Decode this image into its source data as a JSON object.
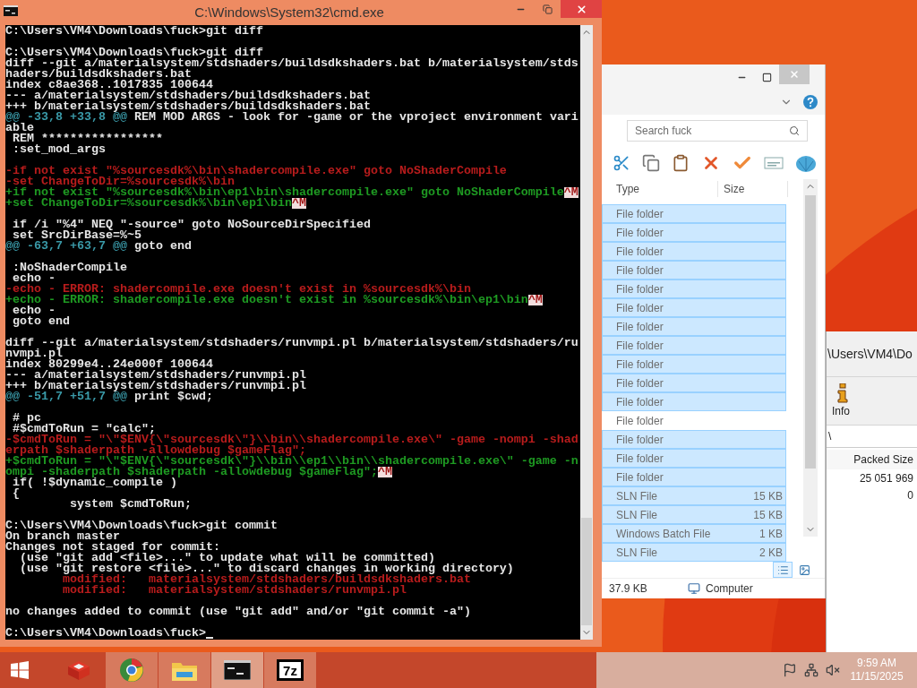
{
  "console_window": {
    "title": "C:\\Windows\\System32\\cmd.exe",
    "lines": [
      {
        "kind": "text",
        "segments": [
          {
            "kind": "text",
            "text": "C:\\Users\\VM4\\Downloads\\fuck>git diff"
          }
        ]
      },
      {
        "kind": "blank"
      },
      {
        "kind": "text",
        "segments": [
          {
            "kind": "text",
            "text": "C:\\Users\\VM4\\Downloads\\fuck>git diff"
          }
        ]
      },
      {
        "kind": "text",
        "segments": [
          {
            "kind": "text",
            "text": "diff --git a/materialsystem/stdshaders/buildsdkshaders.bat b/materialsystem/stds"
          }
        ]
      },
      {
        "kind": "text",
        "segments": [
          {
            "kind": "text",
            "text": "haders/buildsdkshaders.bat"
          }
        ]
      },
      {
        "kind": "text",
        "segments": [
          {
            "kind": "text",
            "text": "index c8ae368..1017835 100644"
          }
        ]
      },
      {
        "kind": "text",
        "segments": [
          {
            "kind": "text",
            "text": "--- a/materialsystem/stdshaders/buildsdkshaders.bat"
          }
        ]
      },
      {
        "kind": "text",
        "segments": [
          {
            "kind": "text",
            "text": "+++ b/materialsystem/stdshaders/buildsdkshaders.bat"
          }
        ]
      },
      {
        "kind": "text",
        "segments": [
          {
            "kind": "hunk",
            "text": "@@ -33,8 +33,8 @@"
          },
          {
            "kind": "text",
            "text": " REM MOD ARGS - look for -game or the vproject environment vari"
          }
        ]
      },
      {
        "kind": "text",
        "segments": [
          {
            "kind": "text",
            "text": "able"
          }
        ]
      },
      {
        "kind": "text",
        "segments": [
          {
            "kind": "text",
            "text": " REM *****************"
          }
        ]
      },
      {
        "kind": "text",
        "segments": [
          {
            "kind": "text",
            "text": " :set_mod_args"
          }
        ]
      },
      {
        "kind": "blank"
      },
      {
        "kind": "text",
        "segments": [
          {
            "kind": "removed",
            "text": "-if not exist \"%sourcesdk%\\bin\\shadercompile.exe\" goto NoShaderCompile"
          }
        ]
      },
      {
        "kind": "text",
        "segments": [
          {
            "kind": "removed",
            "text": "-set ChangeToDir=%sourcesdk%\\bin"
          }
        ]
      },
      {
        "kind": "text",
        "segments": [
          {
            "kind": "added",
            "text": "+if not exist \"%sourcesdk%\\bin\\ep1\\bin\\shadercompile.exe\" goto NoShaderCompile"
          },
          {
            "kind": "cr",
            "text": "^M"
          }
        ]
      },
      {
        "kind": "text",
        "segments": [
          {
            "kind": "added",
            "text": "+set ChangeToDir=%sourcesdk%\\bin\\ep1\\bin"
          },
          {
            "kind": "cr",
            "text": "^M"
          }
        ]
      },
      {
        "kind": "blank"
      },
      {
        "kind": "text",
        "segments": [
          {
            "kind": "text",
            "text": " if /i \"%4\" NEQ \"-source\" goto NoSourceDirSpecified"
          }
        ]
      },
      {
        "kind": "text",
        "segments": [
          {
            "kind": "text",
            "text": " set SrcDirBase=%~5"
          }
        ]
      },
      {
        "kind": "text",
        "segments": [
          {
            "kind": "hunk",
            "text": "@@ -63,7 +63,7 @@"
          },
          {
            "kind": "text",
            "text": " goto end"
          }
        ]
      },
      {
        "kind": "blank"
      },
      {
        "kind": "text",
        "segments": [
          {
            "kind": "text",
            "text": " :NoShaderCompile"
          }
        ]
      },
      {
        "kind": "text",
        "segments": [
          {
            "kind": "text",
            "text": " echo -"
          }
        ]
      },
      {
        "kind": "text",
        "segments": [
          {
            "kind": "removed",
            "text": "-echo - ERROR: shadercompile.exe doesn't exist in %sourcesdk%\\bin"
          }
        ]
      },
      {
        "kind": "text",
        "segments": [
          {
            "kind": "added",
            "text": "+echo - ERROR: shadercompile.exe doesn't exist in %sourcesdk%\\bin\\ep1\\bin"
          },
          {
            "kind": "cr",
            "text": "^M"
          }
        ]
      },
      {
        "kind": "text",
        "segments": [
          {
            "kind": "text",
            "text": " echo -"
          }
        ]
      },
      {
        "kind": "text",
        "segments": [
          {
            "kind": "text",
            "text": " goto end"
          }
        ]
      },
      {
        "kind": "blank"
      },
      {
        "kind": "text",
        "segments": [
          {
            "kind": "text",
            "text": "diff --git a/materialsystem/stdshaders/runvmpi.pl b/materialsystem/stdshaders/ru"
          }
        ]
      },
      {
        "kind": "text",
        "segments": [
          {
            "kind": "text",
            "text": "nvmpi.pl"
          }
        ]
      },
      {
        "kind": "text",
        "segments": [
          {
            "kind": "text",
            "text": "index 80299e4..24e000f 100644"
          }
        ]
      },
      {
        "kind": "text",
        "segments": [
          {
            "kind": "text",
            "text": "--- a/materialsystem/stdshaders/runvmpi.pl"
          }
        ]
      },
      {
        "kind": "text",
        "segments": [
          {
            "kind": "text",
            "text": "+++ b/materialsystem/stdshaders/runvmpi.pl"
          }
        ]
      },
      {
        "kind": "text",
        "segments": [
          {
            "kind": "hunk",
            "text": "@@ -51,7 +51,7 @@"
          },
          {
            "kind": "text",
            "text": " print $cwd;"
          }
        ]
      },
      {
        "kind": "blank"
      },
      {
        "kind": "text",
        "segments": [
          {
            "kind": "text",
            "text": " # pc"
          }
        ]
      },
      {
        "kind": "text",
        "segments": [
          {
            "kind": "text",
            "text": " #$cmdToRun = \"calc\";"
          }
        ]
      },
      {
        "kind": "text",
        "segments": [
          {
            "kind": "removed",
            "text": "-$cmdToRun = \"\\\"$ENV{\\\"sourcesdk\\\"}\\\\bin\\\\shadercompile.exe\\\" -game -nompi -shad"
          }
        ]
      },
      {
        "kind": "text",
        "segments": [
          {
            "kind": "removed",
            "text": "erpath $shaderpath -allowdebug $gameFlag\";"
          }
        ]
      },
      {
        "kind": "text",
        "segments": [
          {
            "kind": "added",
            "text": "+$cmdToRun = \"\\\"$ENV{\\\"sourcesdk\\\"}\\\\bin\\\\ep1\\\\bin\\\\shadercompile.exe\\\" -game -n"
          }
        ]
      },
      {
        "kind": "text",
        "segments": [
          {
            "kind": "added",
            "text": "ompi -shaderpath $shaderpath -allowdebug $gameFlag\";"
          },
          {
            "kind": "cr",
            "text": "^M"
          }
        ]
      },
      {
        "kind": "text",
        "segments": [
          {
            "kind": "text",
            "text": " if( !$dynamic_compile )"
          }
        ]
      },
      {
        "kind": "text",
        "segments": [
          {
            "kind": "text",
            "text": " {"
          }
        ]
      },
      {
        "kind": "text",
        "segments": [
          {
            "kind": "text",
            "text": "         system $cmdToRun;"
          }
        ]
      },
      {
        "kind": "blank"
      },
      {
        "kind": "text",
        "segments": [
          {
            "kind": "text",
            "text": "C:\\Users\\VM4\\Downloads\\fuck>git commit"
          }
        ]
      },
      {
        "kind": "text",
        "segments": [
          {
            "kind": "text",
            "text": "On branch master"
          }
        ]
      },
      {
        "kind": "text",
        "segments": [
          {
            "kind": "text",
            "text": "Changes not staged for commit:"
          }
        ]
      },
      {
        "kind": "text",
        "segments": [
          {
            "kind": "text",
            "text": "  (use \"git add <file>...\" to update what will be committed)"
          }
        ]
      },
      {
        "kind": "text",
        "segments": [
          {
            "kind": "text",
            "text": "  (use \"git restore <file>...\" to discard changes in working directory)"
          }
        ]
      },
      {
        "kind": "text",
        "segments": [
          {
            "kind": "modified",
            "text": "        modified:   materialsystem/stdshaders/buildsdkshaders.bat"
          }
        ]
      },
      {
        "kind": "text",
        "segments": [
          {
            "kind": "modified",
            "text": "        modified:   materialsystem/stdshaders/runvmpi.pl"
          }
        ]
      },
      {
        "kind": "blank"
      },
      {
        "kind": "text",
        "segments": [
          {
            "kind": "text",
            "text": "no changes added to commit (use \"git add\" and/or \"git commit -a\")"
          }
        ]
      },
      {
        "kind": "blank"
      },
      {
        "kind": "text",
        "cursor": true,
        "segments": [
          {
            "kind": "text",
            "text": "C:\\Users\\VM4\\Downloads\\fuck>"
          }
        ]
      }
    ]
  },
  "explorer_window": {
    "search": {
      "placeholder": "Search fuck"
    },
    "columns": [
      "Type",
      "Size"
    ],
    "rows": [
      {
        "type": "File folder",
        "selected": true
      },
      {
        "type": "File folder",
        "selected": true
      },
      {
        "type": "File folder",
        "selected": true
      },
      {
        "type": "File folder",
        "selected": true
      },
      {
        "type": "File folder",
        "selected": true
      },
      {
        "type": "File folder",
        "selected": true
      },
      {
        "type": "File folder",
        "selected": true
      },
      {
        "type": "File folder",
        "selected": true
      },
      {
        "type": "File folder",
        "selected": true
      },
      {
        "type": "File folder",
        "selected": true
      },
      {
        "type": "File folder",
        "selected": true
      },
      {
        "type": "File folder",
        "selected": false
      },
      {
        "type": "File folder",
        "selected": true
      },
      {
        "type": "File folder",
        "selected": true
      },
      {
        "type": "File folder",
        "selected": true
      },
      {
        "type": "SLN File",
        "size": "15 KB",
        "selected": true
      },
      {
        "type": "SLN File",
        "size": "15 KB",
        "selected": true
      },
      {
        "type": "Windows Batch File",
        "size": "1 KB",
        "selected": true
      },
      {
        "type": "SLN File",
        "size": "2 KB",
        "selected": true
      }
    ],
    "views": [
      {
        "kind": "details",
        "selected": true
      },
      {
        "kind": "large_icons",
        "selected": false
      }
    ],
    "status_bar": {
      "size": "37.9 KB",
      "location": "Computer"
    }
  },
  "archive_window": {
    "path": "\\Users\\VM4\\Do",
    "toolbar": [
      {
        "label": "Info"
      }
    ],
    "address": "\\",
    "columns": [
      "Packed Size"
    ],
    "rows": [
      {
        "packed_size": "25 051 969"
      },
      {
        "packed_size": "0"
      }
    ]
  },
  "taskbar": {
    "apps": [
      {
        "kind": "box",
        "running": false,
        "selected": false
      },
      {
        "kind": "browser",
        "running": true,
        "selected": false
      },
      {
        "kind": "explorer",
        "running": true,
        "selected": false
      },
      {
        "kind": "console",
        "running": true,
        "selected": true
      },
      {
        "kind": "archiver",
        "running": true,
        "selected": false,
        "logo_text": "7z"
      }
    ],
    "clock": {
      "time": "9:59 AM",
      "date": "11/15/2025"
    }
  }
}
